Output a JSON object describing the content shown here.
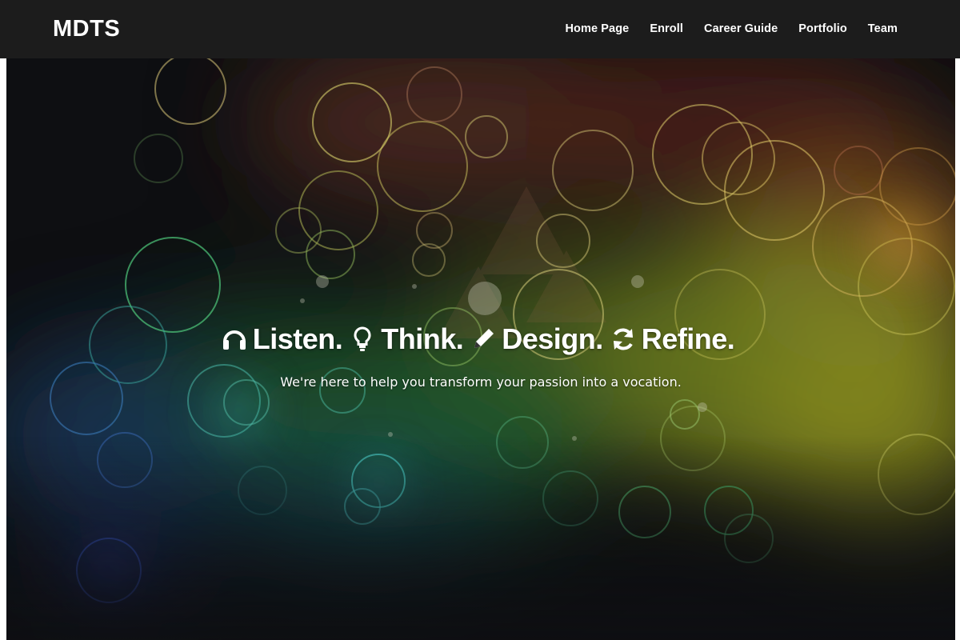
{
  "navbar": {
    "brand": "MDTS",
    "links": [
      {
        "label": "Home Page"
      },
      {
        "label": "Enroll"
      },
      {
        "label": "Career Guide"
      },
      {
        "label": "Portfolio"
      },
      {
        "label": "Team"
      }
    ]
  },
  "hero": {
    "headline": [
      {
        "icon": "headphones-icon",
        "text": "Listen."
      },
      {
        "icon": "lightbulb-icon",
        "text": "Think."
      },
      {
        "icon": "pencil-icon",
        "text": "Design."
      },
      {
        "icon": "refresh-icon",
        "text": "Refine."
      }
    ],
    "subline": "We're here to help you transform your passion into a vocation."
  },
  "colors": {
    "navbar_bg": "#1c1c1c",
    "hero_bg": "#0e0f12",
    "text": "#ffffff"
  }
}
